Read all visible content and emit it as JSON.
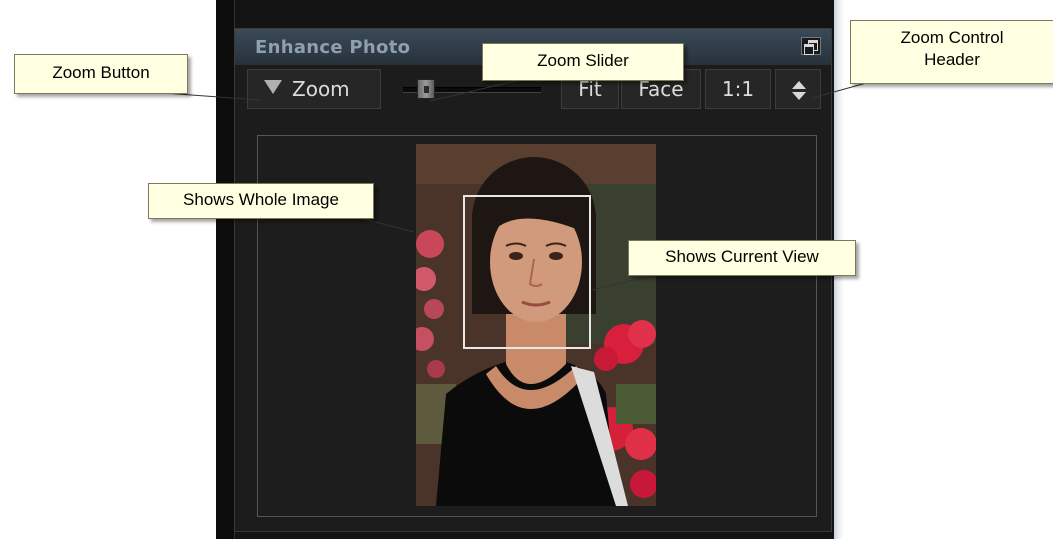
{
  "panel": {
    "title": "Enhance Photo"
  },
  "zoom_controls": {
    "zoom_label": "Zoom",
    "fit_label": "Fit",
    "face_label": "Face",
    "one_to_one_label": "1:1"
  },
  "callouts": {
    "zoom_button": "Zoom Button",
    "zoom_slider": "Zoom Slider",
    "zoom_control_header_line1": "Zoom Control",
    "zoom_control_header_line2": "Header",
    "shows_whole_image": "Shows Whole Image",
    "shows_current_view": "Shows Current View"
  },
  "icons": {
    "restore": "restore-window-icon",
    "dropdown": "triangle-down-icon",
    "expand": "up-down-arrows-icon"
  },
  "colors": {
    "panel_bg": "#1c1c1c",
    "header_bg": "#27313a",
    "title_color": "#8f9fae",
    "callout_bg": "#ffffe1"
  }
}
